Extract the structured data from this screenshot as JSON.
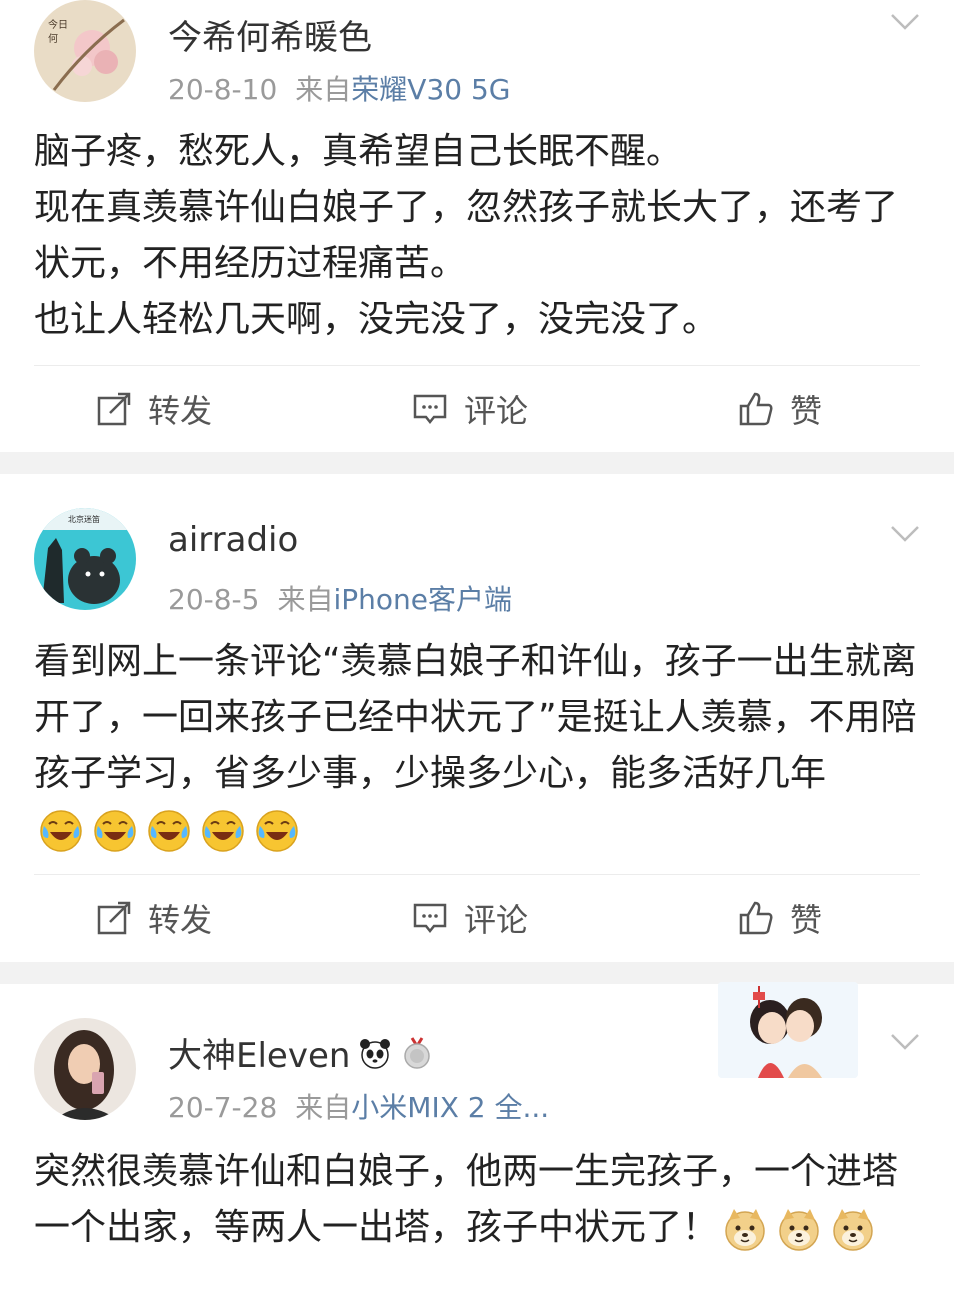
{
  "posts": [
    {
      "username": "今希何希暖色",
      "date": "20-8-10",
      "from_label": "来自",
      "source": "荣耀V30 5G",
      "content": [
        "脑子疼，愁死人，真希望自己长眠不醒。",
        "现在真羡慕许仙白娘子了，忽然孩子就长大了，还考了状元，不用经历过程痛苦。",
        "也让人轻松几天啊，没完没了，没完没了。"
      ],
      "actions": {
        "repost": "转发",
        "comment": "评论",
        "like": "赞"
      }
    },
    {
      "username": "airradio",
      "date": "20-8-5",
      "from_label": "来自",
      "source": "iPhone客户端",
      "content": [
        "看到网上一条评论“羡慕白娘子和许仙，孩子一出生就离开了，一回来孩子已经中状元了”是挺让人羡慕，不用陪孩子学习，省多少事，少操多少心，能多活好几年"
      ],
      "emoji_count": 5,
      "actions": {
        "repost": "转发",
        "comment": "评论",
        "like": "赞"
      }
    },
    {
      "username": "大神Eleven",
      "date": "20-7-28",
      "from_label": "来自",
      "source": "小米MIX 2 全...",
      "content": [
        "突然很羡慕许仙和白娘子，他两一生完孩子，一个进塔一个出家，等两人一出塔，孩子中状元了！"
      ],
      "emoji_count": 3
    }
  ],
  "colors": {
    "source_link": "#5b7ea6",
    "meta_gray": "#9a9a9a",
    "separator": "#f2f2f2"
  },
  "icons": [
    "repost-icon",
    "comment-icon",
    "like-icon",
    "chevron-down-icon",
    "laugh-cry-emoji",
    "doge-emoji",
    "panda-badge-icon",
    "medal-badge-icon"
  ]
}
